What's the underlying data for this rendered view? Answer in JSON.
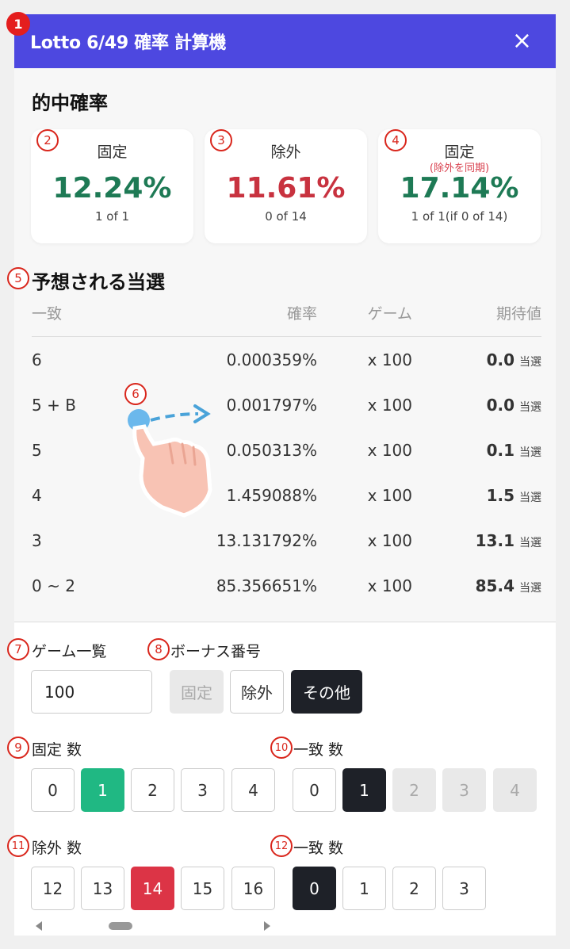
{
  "header": {
    "title": "Lotto 6/49 確率 計算機",
    "close_label": "×"
  },
  "badges": [
    "1",
    "2",
    "3",
    "4",
    "5",
    "6",
    "7",
    "8",
    "9",
    "10",
    "11",
    "12"
  ],
  "hit_rate": {
    "title": "的中確率",
    "cards": [
      {
        "label": "固定",
        "sub": "",
        "value": "12.24%",
        "footer": "1 of 1"
      },
      {
        "label": "除外",
        "sub": "",
        "value": "11.61%",
        "footer": "0 of 14"
      },
      {
        "label": "固定",
        "sub": "(除外を同期)",
        "value": "17.14%",
        "footer": "1 of 1(if 0 of 14)"
      }
    ]
  },
  "expected": {
    "title": "予想される当選",
    "headers": [
      "一致",
      "確率",
      "ゲーム",
      "期待値"
    ],
    "unit": "当選",
    "rows": [
      {
        "match": "6",
        "prob": "0.000359%",
        "games": "x 100",
        "ev": "0.0"
      },
      {
        "match": "5 + B",
        "prob": "0.001797%",
        "games": "x 100",
        "ev": "0.0"
      },
      {
        "match": "5",
        "prob": "0.050313%",
        "games": "x 100",
        "ev": "0.1"
      },
      {
        "match": "4",
        "prob": "1.459088%",
        "games": "x 100",
        "ev": "1.5"
      },
      {
        "match": "3",
        "prob": "13.131792%",
        "games": "x 100",
        "ev": "13.1"
      },
      {
        "match": "0 ~ 2",
        "prob": "85.356651%",
        "games": "x 100",
        "ev": "85.4"
      }
    ]
  },
  "games": {
    "label": "ゲーム一覧",
    "value": "100"
  },
  "bonus": {
    "label": "ボーナス番号",
    "options": [
      "固定",
      "除外",
      "その他"
    ],
    "selected": "その他"
  },
  "fixed_count": {
    "label": "固定 数",
    "options": [
      "0",
      "1",
      "2",
      "3",
      "4"
    ],
    "selected": "1"
  },
  "fixed_match": {
    "label": "一致 数",
    "options": [
      "0",
      "1",
      "2",
      "3",
      "4"
    ],
    "selected": "1"
  },
  "excluded_count": {
    "label": "除外 数",
    "options": [
      "12",
      "13",
      "14",
      "15",
      "16"
    ],
    "selected": "14"
  },
  "excluded_match": {
    "label": "一致 数",
    "options": [
      "0",
      "1",
      "2",
      "3"
    ],
    "selected": "0"
  },
  "colors": {
    "header": "#4d48e0",
    "green": "#1e7a55",
    "red": "#c8323f",
    "selected_green": "#20b883",
    "selected_red": "#dc3446",
    "selected_dark": "#1e2128"
  }
}
